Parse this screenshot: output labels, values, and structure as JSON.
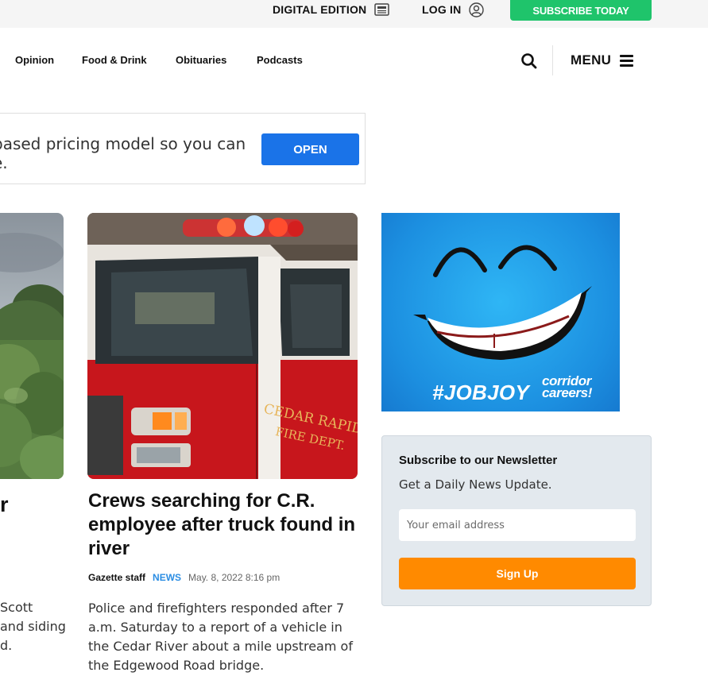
{
  "utility": {
    "digital_edition": "DIGITAL EDITION",
    "login": "LOG IN",
    "subscribe": "SUBSCRIBE TODAY"
  },
  "nav": {
    "links": [
      "Opinion",
      "Food & Drink",
      "Obituaries",
      "Podcasts"
    ],
    "menu": "MENU",
    "icons": [
      "search-icon",
      "hamburger-icon"
    ]
  },
  "ad_banner": {
    "text": "based pricing model so you can e.",
    "button": "OPEN"
  },
  "left_card": {
    "headline_fragment": "r",
    "summary_fragments": [
      "Scott",
      "and siding",
      "d."
    ]
  },
  "article": {
    "title": "Crews searching for C.R. employee after truck found in river",
    "author": "Gazette staff",
    "category": "NEWS",
    "date": "May. 8, 2022 8:16 pm",
    "summary": "Police and firefighters responded after 7 a.m. Saturday to a report of a vehicle in the Cedar River about a mile upstream of the Edgewood Road bridge.",
    "image_text": "CEDAR RAPIDS FIRE DEPT."
  },
  "jobjoy_ad": {
    "hashtag": "#JOBJOY",
    "brand_line1": "corridor",
    "brand_line2": "careers",
    "brand_mark": "!"
  },
  "newsletter": {
    "title": "Subscribe to our Newsletter",
    "subtitle": "Get a Daily News Update.",
    "email_placeholder": "Your email address",
    "button": "Sign Up"
  },
  "colors": {
    "subscribe_green": "#1fc46b",
    "open_blue": "#1a73e8",
    "category_blue": "#2b8de3",
    "signup_orange": "#ff8a00",
    "newsletter_bg": "#e3e9ee"
  }
}
